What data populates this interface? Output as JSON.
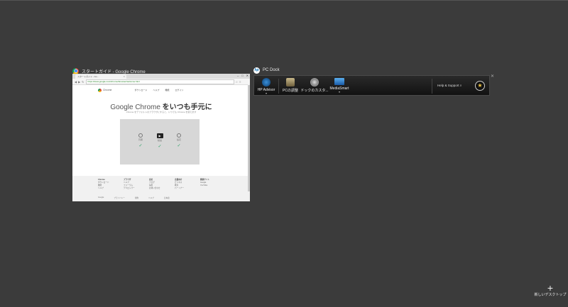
{
  "windows": {
    "chrome": {
      "title": "スタートガイド - Google Chrome",
      "tab_title": "スタートガイド - Go...",
      "url": "https://www.google.com/chrome/browser/welcome.html",
      "page": {
        "brand": "Chrome",
        "nav_items": [
          "ダウンロード",
          "ヘルプ",
          "機能",
          "ログイン"
        ],
        "heading_latin": "Google Chrome",
        "heading_jp": " をいつも手元に",
        "subtitle": "Chrome をデフォルトのブラウザにすると、いつでも Chrome を使えます",
        "features": [
          {
            "label": "同期",
            "icon": "sync-icon"
          },
          {
            "label": "動画",
            "icon": "play-icon"
          },
          {
            "label": "設定",
            "icon": "settings-icon"
          }
        ],
        "footer_columns": [
          {
            "head": "Chrome",
            "items": [
              "ダウンロード",
              "機能",
              "ヘルプ"
            ]
          },
          {
            "head": "ブラウザ",
            "items": [
              "ヘルプ",
              "フォーラム",
              "デベロッパー"
            ]
          },
          {
            "head": "会社",
            "items": [
              "ブログ",
              "採用",
              "お問い合わせ"
            ]
          },
          {
            "head": "企業向け",
            "items": [
              "ビジネス",
              "教育",
              "パートナー"
            ]
          },
          {
            "head": "関連サイト",
            "items": [
              "Google",
              "YouTube"
            ]
          }
        ],
        "footer_bottom": [
          "Google",
          "プライバシー",
          "規約",
          "ヘルプ",
          "日本語"
        ]
      }
    },
    "dock": {
      "title": "PC Dock",
      "items": [
        {
          "label": "HP Advisor",
          "icon": "hp-advisor-icon",
          "has_menu": true
        },
        {
          "label": "PCの調整",
          "icon": "pc-tune-icon",
          "has_menu": false
        },
        {
          "label": "ドックのカスタ...",
          "icon": "dock-customize-icon",
          "has_menu": false
        },
        {
          "label": "MediaSmart",
          "icon": "mediasmart-icon",
          "has_menu": true
        }
      ],
      "help_label": "Help & Support",
      "search_icon": "search-icon",
      "favorite_icon": "star-icon"
    }
  },
  "new_desktop": {
    "label": "新しいデスクトップ"
  },
  "colors": {
    "background": "#3b3b3b",
    "dock_bg": "#1c1c1c",
    "accent_check": "#2aa266"
  }
}
